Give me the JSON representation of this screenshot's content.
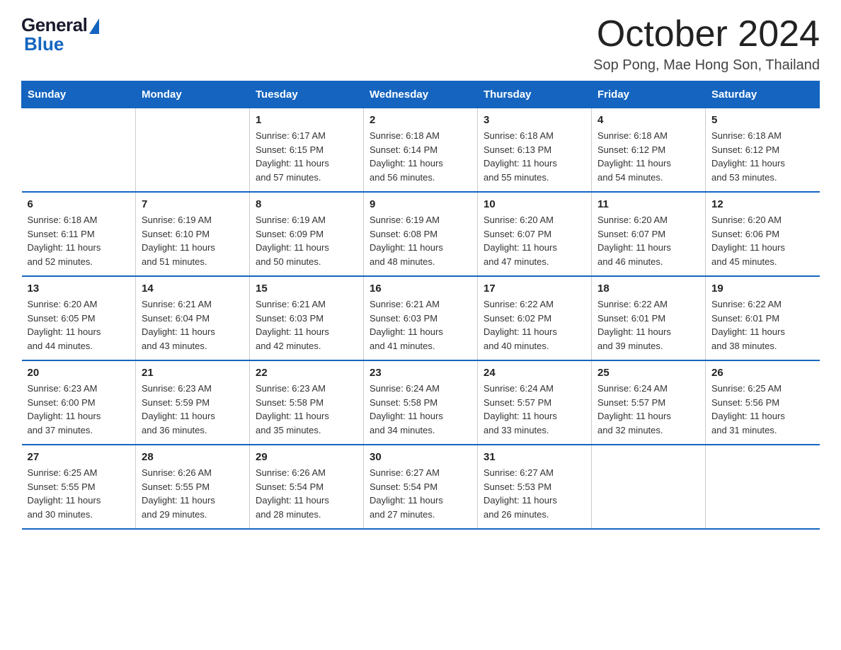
{
  "header": {
    "logo_general": "General",
    "logo_blue": "Blue",
    "month": "October 2024",
    "location": "Sop Pong, Mae Hong Son, Thailand"
  },
  "days_of_week": [
    "Sunday",
    "Monday",
    "Tuesday",
    "Wednesday",
    "Thursday",
    "Friday",
    "Saturday"
  ],
  "weeks": [
    [
      {
        "num": "",
        "detail": ""
      },
      {
        "num": "",
        "detail": ""
      },
      {
        "num": "1",
        "detail": "Sunrise: 6:17 AM\nSunset: 6:15 PM\nDaylight: 11 hours\nand 57 minutes."
      },
      {
        "num": "2",
        "detail": "Sunrise: 6:18 AM\nSunset: 6:14 PM\nDaylight: 11 hours\nand 56 minutes."
      },
      {
        "num": "3",
        "detail": "Sunrise: 6:18 AM\nSunset: 6:13 PM\nDaylight: 11 hours\nand 55 minutes."
      },
      {
        "num": "4",
        "detail": "Sunrise: 6:18 AM\nSunset: 6:12 PM\nDaylight: 11 hours\nand 54 minutes."
      },
      {
        "num": "5",
        "detail": "Sunrise: 6:18 AM\nSunset: 6:12 PM\nDaylight: 11 hours\nand 53 minutes."
      }
    ],
    [
      {
        "num": "6",
        "detail": "Sunrise: 6:18 AM\nSunset: 6:11 PM\nDaylight: 11 hours\nand 52 minutes."
      },
      {
        "num": "7",
        "detail": "Sunrise: 6:19 AM\nSunset: 6:10 PM\nDaylight: 11 hours\nand 51 minutes."
      },
      {
        "num": "8",
        "detail": "Sunrise: 6:19 AM\nSunset: 6:09 PM\nDaylight: 11 hours\nand 50 minutes."
      },
      {
        "num": "9",
        "detail": "Sunrise: 6:19 AM\nSunset: 6:08 PM\nDaylight: 11 hours\nand 48 minutes."
      },
      {
        "num": "10",
        "detail": "Sunrise: 6:20 AM\nSunset: 6:07 PM\nDaylight: 11 hours\nand 47 minutes."
      },
      {
        "num": "11",
        "detail": "Sunrise: 6:20 AM\nSunset: 6:07 PM\nDaylight: 11 hours\nand 46 minutes."
      },
      {
        "num": "12",
        "detail": "Sunrise: 6:20 AM\nSunset: 6:06 PM\nDaylight: 11 hours\nand 45 minutes."
      }
    ],
    [
      {
        "num": "13",
        "detail": "Sunrise: 6:20 AM\nSunset: 6:05 PM\nDaylight: 11 hours\nand 44 minutes."
      },
      {
        "num": "14",
        "detail": "Sunrise: 6:21 AM\nSunset: 6:04 PM\nDaylight: 11 hours\nand 43 minutes."
      },
      {
        "num": "15",
        "detail": "Sunrise: 6:21 AM\nSunset: 6:03 PM\nDaylight: 11 hours\nand 42 minutes."
      },
      {
        "num": "16",
        "detail": "Sunrise: 6:21 AM\nSunset: 6:03 PM\nDaylight: 11 hours\nand 41 minutes."
      },
      {
        "num": "17",
        "detail": "Sunrise: 6:22 AM\nSunset: 6:02 PM\nDaylight: 11 hours\nand 40 minutes."
      },
      {
        "num": "18",
        "detail": "Sunrise: 6:22 AM\nSunset: 6:01 PM\nDaylight: 11 hours\nand 39 minutes."
      },
      {
        "num": "19",
        "detail": "Sunrise: 6:22 AM\nSunset: 6:01 PM\nDaylight: 11 hours\nand 38 minutes."
      }
    ],
    [
      {
        "num": "20",
        "detail": "Sunrise: 6:23 AM\nSunset: 6:00 PM\nDaylight: 11 hours\nand 37 minutes."
      },
      {
        "num": "21",
        "detail": "Sunrise: 6:23 AM\nSunset: 5:59 PM\nDaylight: 11 hours\nand 36 minutes."
      },
      {
        "num": "22",
        "detail": "Sunrise: 6:23 AM\nSunset: 5:58 PM\nDaylight: 11 hours\nand 35 minutes."
      },
      {
        "num": "23",
        "detail": "Sunrise: 6:24 AM\nSunset: 5:58 PM\nDaylight: 11 hours\nand 34 minutes."
      },
      {
        "num": "24",
        "detail": "Sunrise: 6:24 AM\nSunset: 5:57 PM\nDaylight: 11 hours\nand 33 minutes."
      },
      {
        "num": "25",
        "detail": "Sunrise: 6:24 AM\nSunset: 5:57 PM\nDaylight: 11 hours\nand 32 minutes."
      },
      {
        "num": "26",
        "detail": "Sunrise: 6:25 AM\nSunset: 5:56 PM\nDaylight: 11 hours\nand 31 minutes."
      }
    ],
    [
      {
        "num": "27",
        "detail": "Sunrise: 6:25 AM\nSunset: 5:55 PM\nDaylight: 11 hours\nand 30 minutes."
      },
      {
        "num": "28",
        "detail": "Sunrise: 6:26 AM\nSunset: 5:55 PM\nDaylight: 11 hours\nand 29 minutes."
      },
      {
        "num": "29",
        "detail": "Sunrise: 6:26 AM\nSunset: 5:54 PM\nDaylight: 11 hours\nand 28 minutes."
      },
      {
        "num": "30",
        "detail": "Sunrise: 6:27 AM\nSunset: 5:54 PM\nDaylight: 11 hours\nand 27 minutes."
      },
      {
        "num": "31",
        "detail": "Sunrise: 6:27 AM\nSunset: 5:53 PM\nDaylight: 11 hours\nand 26 minutes."
      },
      {
        "num": "",
        "detail": ""
      },
      {
        "num": "",
        "detail": ""
      }
    ]
  ]
}
